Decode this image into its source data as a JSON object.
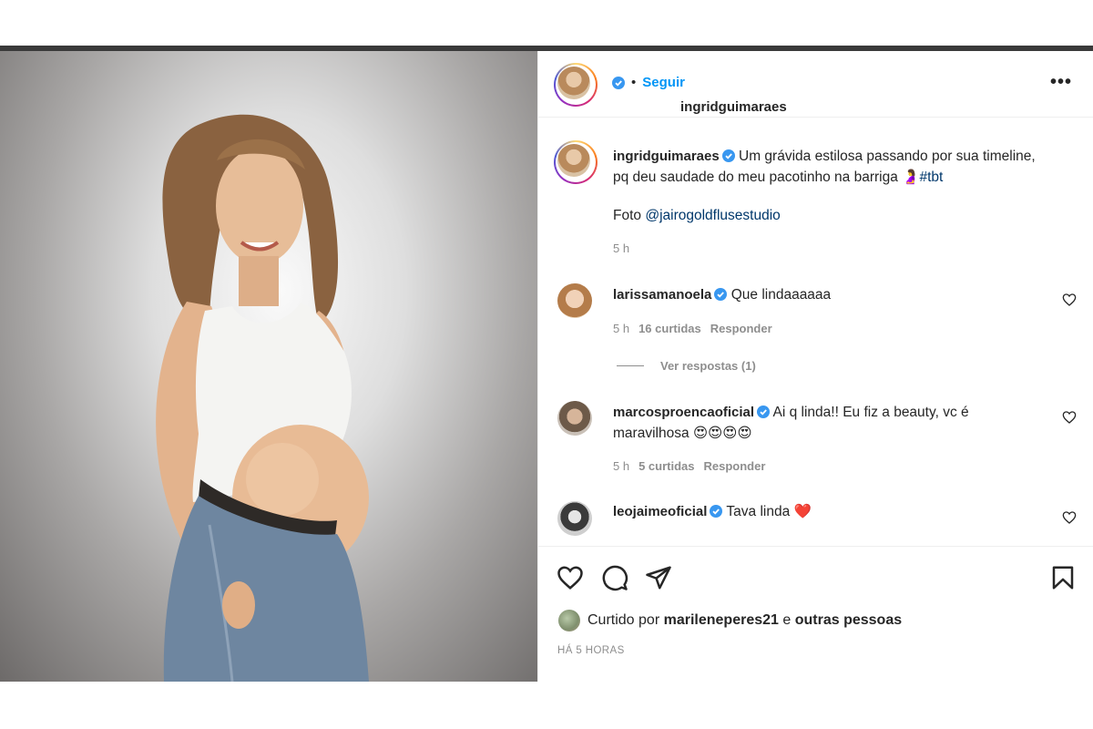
{
  "post": {
    "author": "ingridguimaraes",
    "follow_label": "Seguir",
    "separator": "•",
    "more_label": "•••"
  },
  "caption": {
    "author": "ingridguimaraes",
    "line1": "Um grávida estilosa passando por sua timeline,",
    "line2": "pq deu saudade do meu pacotinho na barriga",
    "emoji": "🤰",
    "hashtag": "#tbt",
    "photo_prefix": "Foto",
    "photo_credit": "@jairogoldflusestudio",
    "time": "5 h"
  },
  "comments": [
    {
      "author": "larissamanoela",
      "text": "Que lindaaaaaa",
      "time": "5 h",
      "likes": "16 curtidas",
      "reply_label": "Responder"
    },
    {
      "author": "marcosproencaoficial",
      "text_line1": "Ai q linda!! Eu fiz a beauty, vc é",
      "text_line2": "maravilhosa 😍😍😍😍",
      "time": "5 h",
      "likes": "5 curtidas",
      "reply_label": "Responder"
    },
    {
      "author": "leojaimeoficial",
      "text": "Tava linda ❤️"
    }
  ],
  "view_replies": "Ver respostas (1)",
  "likes": {
    "prefix": "Curtido por",
    "user": "marileneperes21",
    "connector": "e",
    "others": "outras pessoas"
  },
  "posted_ago": "HÁ 5 HORAS",
  "colors": {
    "link_blue": "#0095f6",
    "verified_blue": "#3897f0",
    "muted": "#8e8e8e",
    "text": "#262626"
  },
  "icons": [
    "verified-badge-icon",
    "more-icon",
    "heart-icon",
    "comment-icon",
    "share-icon",
    "bookmark-icon"
  ]
}
